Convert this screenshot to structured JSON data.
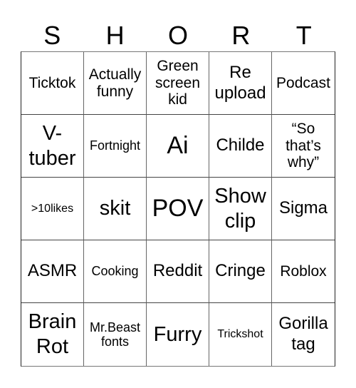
{
  "card": {
    "header": [
      "S",
      "H",
      "O",
      "R",
      "T"
    ],
    "cells": [
      [
        "Ticktok",
        "Actually funny",
        "Green screen kid",
        "Re upload",
        "Podcast"
      ],
      [
        "V-tuber",
        "Fortnight",
        "Ai",
        "Childe",
        "“So that’s why”"
      ],
      [
        ">10likes",
        "skit",
        "POV",
        "Show clip",
        "Sigma"
      ],
      [
        "ASMR",
        "Cooking",
        "Reddit",
        "Cringe",
        "Roblox"
      ],
      [
        "Brain Rot",
        "Mr.Beast fonts",
        "Furry",
        "Trickshot",
        "Gorilla tag"
      ]
    ]
  }
}
